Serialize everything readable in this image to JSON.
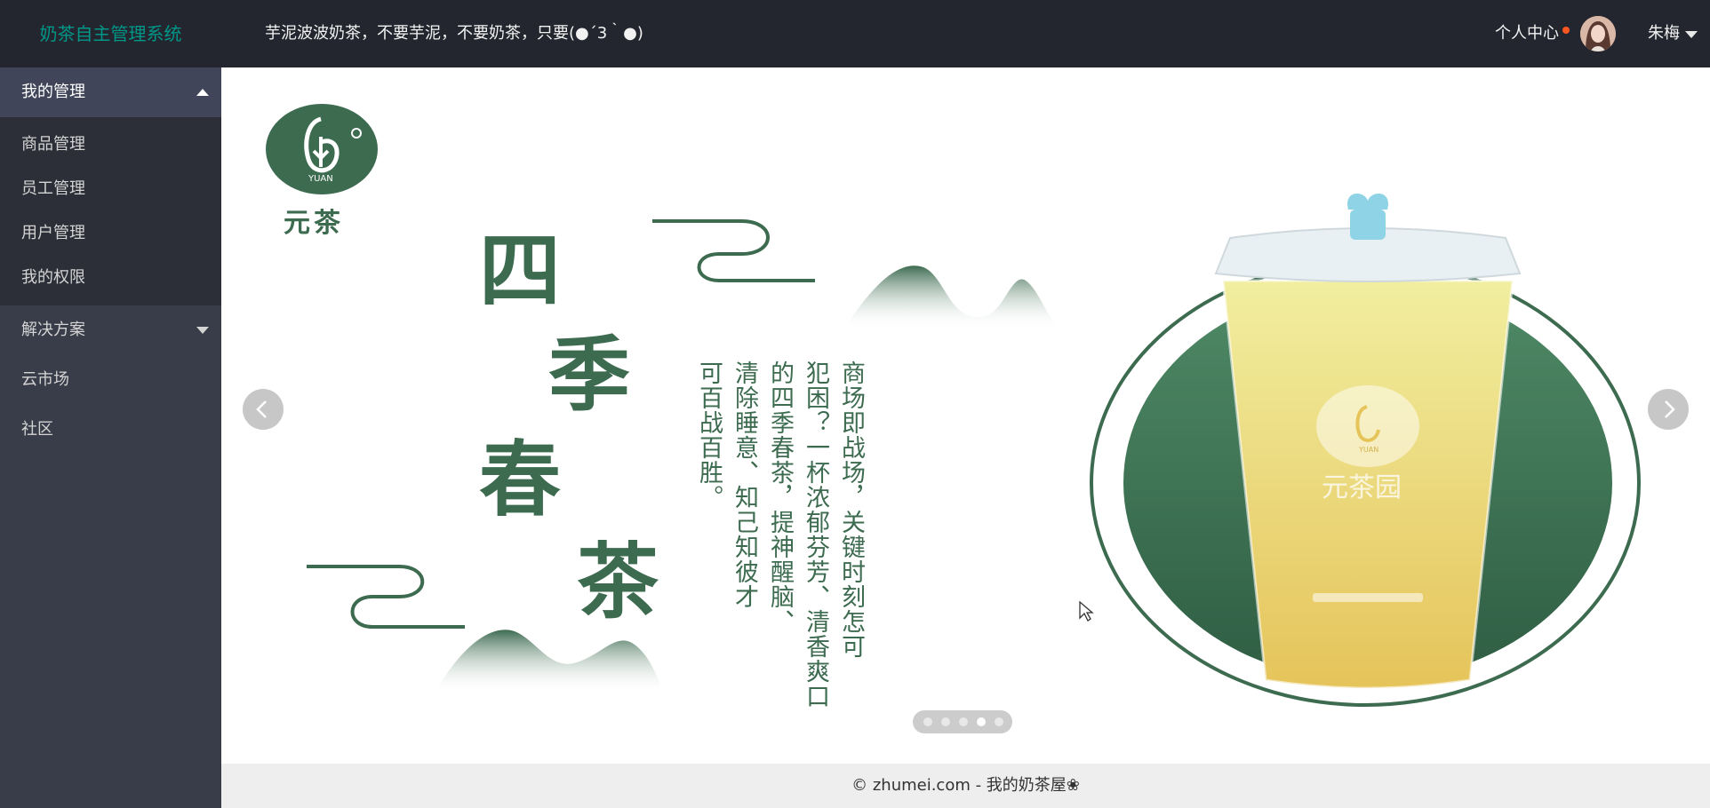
{
  "header": {
    "logo": "奶茶自主管理系统",
    "slogan": "芋泥波波奶茶，不要芋泥，不要奶茶，只要(●´3｀●)",
    "personal_center": "个人中心",
    "username": "朱梅"
  },
  "sidebar": {
    "groups": [
      {
        "title": "我的管理",
        "expanded": true,
        "items": [
          {
            "label": "商品管理"
          },
          {
            "label": "员工管理"
          },
          {
            "label": "用户管理"
          },
          {
            "label": "我的权限"
          }
        ]
      },
      {
        "title": "解决方案",
        "expanded": false
      }
    ],
    "items": [
      {
        "label": "云市场"
      },
      {
        "label": "社区"
      }
    ]
  },
  "carousel": {
    "slide_count": 5,
    "active_index": 3,
    "slide": {
      "logo_text": "YUAN",
      "brand_name": "元茶",
      "title_chars": [
        "四",
        "季",
        "春",
        "茶"
      ],
      "copy_lines": [
        "商场即战场，关键时刻怎可",
        "犯困？一杯浓郁芬芳、清香爽口",
        "的四季春茶，提神醒脑、",
        "清除睡意、知己知彼才",
        "可百战百胜。"
      ],
      "cup_brand": "元茶园",
      "cup_logo_text": "YUAN"
    }
  },
  "footer": {
    "text": "© zhumei.com - 我的奶茶屋❀"
  },
  "colors": {
    "header_bg": "#23262e",
    "sidebar_bg": "#393d49",
    "accent": "#009688",
    "brand_green": "#3d6b50",
    "badge": "#ff5722"
  }
}
